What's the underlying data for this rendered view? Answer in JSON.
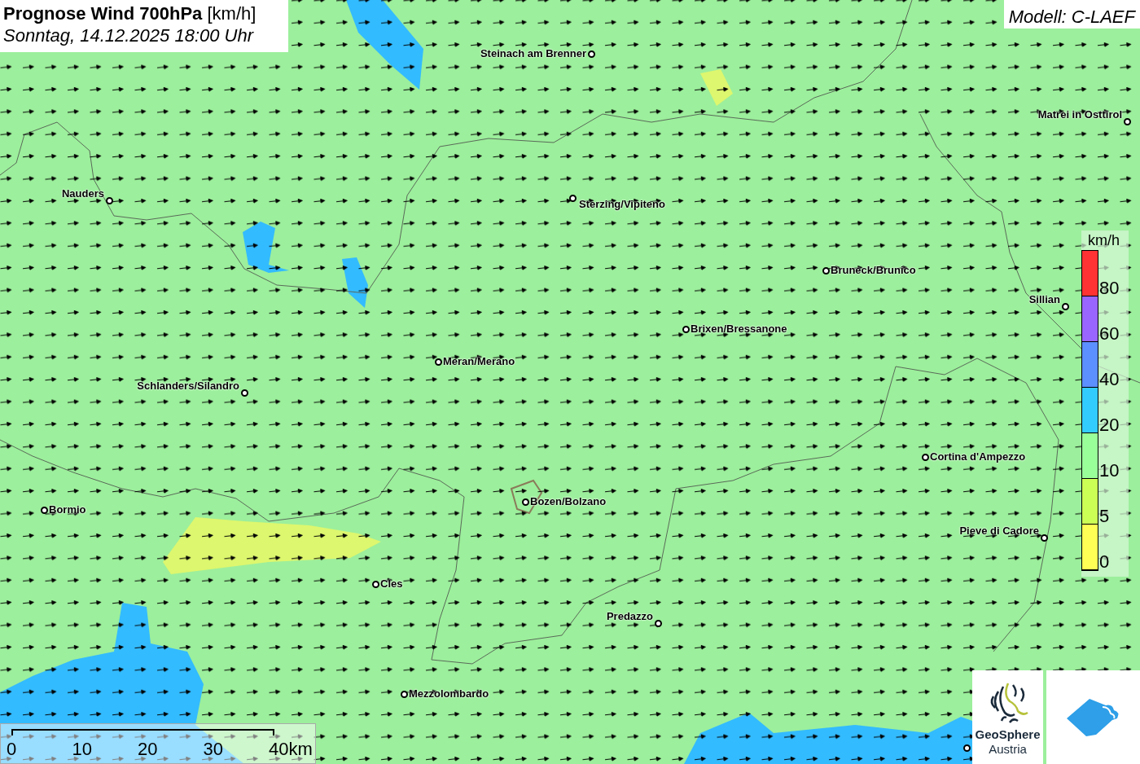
{
  "title": {
    "main": "Prognose Wind 700hPa",
    "unit": "[km/h]",
    "subtitle": "Sonntag, 14.12.2025 18:00 Uhr"
  },
  "model": "Modell: C-LAEF",
  "cities": [
    {
      "name": "Steinach am Brenner"
    },
    {
      "name": "Matrei in Osttirol"
    },
    {
      "name": "Nauders"
    },
    {
      "name": "Sterzing/Vipiteno"
    },
    {
      "name": "Bruneck/Brunico"
    },
    {
      "name": "Sillian"
    },
    {
      "name": "Brixen/Bressanone"
    },
    {
      "name": "Meran/Merano"
    },
    {
      "name": "Schlanders/Silandro"
    },
    {
      "name": "Cortina d'Ampezzo"
    },
    {
      "name": "Bormio"
    },
    {
      "name": "Bozen/Bolzano"
    },
    {
      "name": "Pieve di Cadore"
    },
    {
      "name": "Cles"
    },
    {
      "name": "Predazzo"
    },
    {
      "name": "Mezzolombardo"
    }
  ],
  "legend": {
    "unit": "km/h",
    "bands": [
      {
        "color": "#ff3333",
        "label": "80"
      },
      {
        "color": "#9966ff",
        "label": "60"
      },
      {
        "color": "#5c8fff",
        "label": "40"
      },
      {
        "color": "#33ccff",
        "label": "20"
      },
      {
        "color": "#99ff99",
        "label": "10"
      },
      {
        "color": "#ccff55",
        "label": "5"
      },
      {
        "color": "#ffff55",
        "label": "0"
      }
    ]
  },
  "scale_bar": {
    "ticks": [
      "0",
      "10",
      "20",
      "30",
      "40km"
    ]
  },
  "logo": {
    "line1": "GeoSphere",
    "line2": "Austria"
  }
}
